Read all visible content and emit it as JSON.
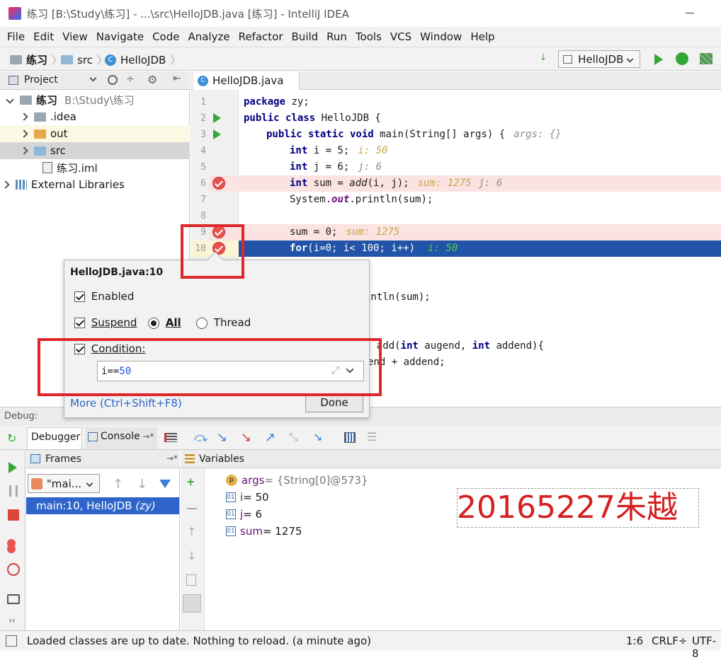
{
  "window": {
    "title": "练习 [B:\\Study\\练习] - ...\\src\\HelloJDB.java [练习] - IntelliJ IDEA"
  },
  "menu": [
    "File",
    "Edit",
    "View",
    "Navigate",
    "Code",
    "Analyze",
    "Refactor",
    "Build",
    "Run",
    "Tools",
    "VCS",
    "Window",
    "Help"
  ],
  "breadcrumb": [
    "练习",
    "src",
    "HelloJDB"
  ],
  "run_config": {
    "label": "HelloJDB"
  },
  "project": {
    "header": "Project",
    "root_label": "练习",
    "root_path": "B:\\Study\\练习",
    "items": [
      ".idea",
      "out",
      "src",
      "练习.iml",
      "External Libraries"
    ]
  },
  "editor": {
    "tab": "HelloJDB.java",
    "lines": [
      {
        "n": "1",
        "text": ""
      },
      {
        "n": "2",
        "text": ""
      },
      {
        "n": "3",
        "text": ""
      },
      {
        "n": "4",
        "text": ""
      },
      {
        "n": "5",
        "text": ""
      },
      {
        "n": "6",
        "text": ""
      },
      {
        "n": "7",
        "text": ""
      },
      {
        "n": "8",
        "text": ""
      },
      {
        "n": "9",
        "text": ""
      },
      {
        "n": "10",
        "text": ""
      }
    ],
    "code": {
      "l1a": "package ",
      "l1b": "zy;",
      "l2a": "public class ",
      "l2b": "HelloJDB {",
      "l3a": "public static void ",
      "l3b": "main(String[] args) {",
      "l3h": "args: {}",
      "l4a": "int ",
      "l4b": "i = 5;",
      "l4h": "i: 50",
      "l5a": "int ",
      "l5b": "j = 6;",
      "l5h": "j: 6",
      "l6a": "int ",
      "l6b": "sum = ",
      "l6c": "add",
      "l6d": "(i, j);",
      "l6h": "sum: 1275",
      "l6h2": "j: 6",
      "l7a": "System.",
      "l7b": "out",
      "l7c": ".println(sum);",
      "l9a": "sum = 0;",
      "l9h": "sum: 1275",
      "l10a": "for",
      "l10b": "(i=0; i< 100; i++)",
      "l10h": "i: 50",
      "l13": "intln(sum);",
      "l16a": "t ",
      "l16b": "add(",
      "l16c": "int ",
      "l16d": "augend, ",
      "l16e": "int ",
      "l16f": "addend){",
      "l17": "end + addend;"
    }
  },
  "popup": {
    "title": "HelloJDB.java:10",
    "enabled": "Enabled",
    "suspend": "Suspend",
    "all": "All",
    "thread": "Thread",
    "condition": "Condition:",
    "condition_value_a": "i==",
    "condition_value_b": "50",
    "more": "More (Ctrl+Shift+F8)",
    "done": "Done"
  },
  "debug": {
    "label": "Debug:",
    "tab_debugger": "Debugger",
    "tab_console": "Console",
    "frames_title": "Frames",
    "thread_select": "\"mai...",
    "frame": "main:10, HelloJDB",
    "frame_pkg": "(zy)",
    "variables_title": "Variables",
    "vars": [
      {
        "icon": "p",
        "name": "args",
        "value": " = {String[0]@573}"
      },
      {
        "icon": "01",
        "name": "i",
        "value": " = 50"
      },
      {
        "icon": "01",
        "name": "j",
        "value": " = 6"
      },
      {
        "icon": "01",
        "name": "sum",
        "value": " = 1275"
      }
    ],
    "watermark": "20165227朱越"
  },
  "status": {
    "message": "Loaded classes are up to date. Nothing to reload. (a minute ago)",
    "position": "1:6",
    "line_sep": "CRLF÷",
    "encoding": "UTF-8"
  },
  "colors": {
    "accent": "#2f65ca",
    "breakpoint": "#e8534f",
    "highlight": "#2153a8",
    "redbox": "#e0262b"
  }
}
